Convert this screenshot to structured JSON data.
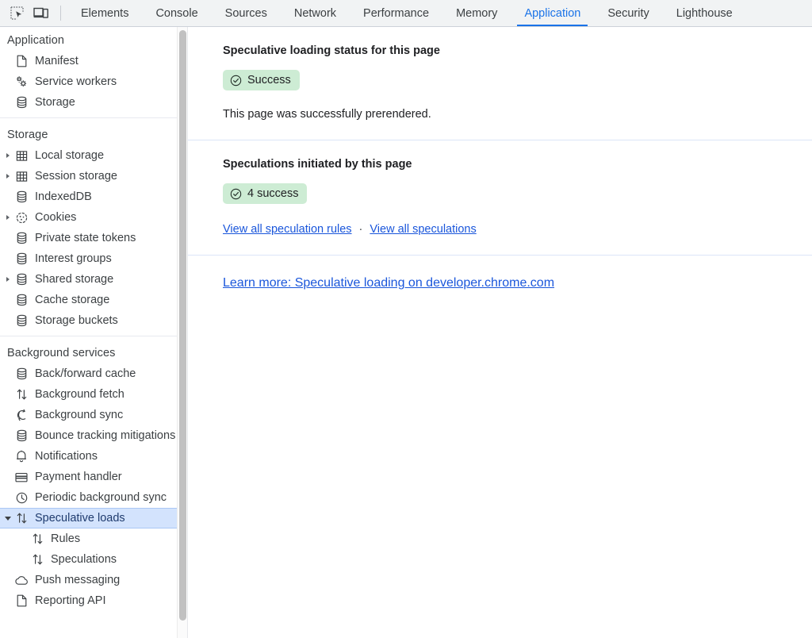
{
  "toolbar": {
    "icons": [
      {
        "name": "inspect-element-icon",
        "title": "Inspect element"
      },
      {
        "name": "device-toolbar-icon",
        "title": "Toggle device toolbar"
      }
    ],
    "tabs": [
      {
        "label": "Elements",
        "active": false
      },
      {
        "label": "Console",
        "active": false
      },
      {
        "label": "Sources",
        "active": false
      },
      {
        "label": "Network",
        "active": false
      },
      {
        "label": "Performance",
        "active": false
      },
      {
        "label": "Memory",
        "active": false
      },
      {
        "label": "Application",
        "active": true
      },
      {
        "label": "Security",
        "active": false
      },
      {
        "label": "Lighthouse",
        "active": false
      }
    ],
    "accent_color": "#1a73e8",
    "background_color": "#f1f3f4"
  },
  "sidebar": {
    "sections": [
      {
        "header": "Application",
        "items": [
          {
            "label": "Manifest",
            "icon": "document-icon",
            "arrow": "none",
            "level": 0,
            "selected": false
          },
          {
            "label": "Service workers",
            "icon": "gears-icon",
            "arrow": "none",
            "level": 0,
            "selected": false
          },
          {
            "label": "Storage",
            "icon": "database-icon",
            "arrow": "none",
            "level": 0,
            "selected": false
          }
        ]
      },
      {
        "header": "Storage",
        "items": [
          {
            "label": "Local storage",
            "icon": "table-icon",
            "arrow": "collapsed",
            "level": 0,
            "selected": false
          },
          {
            "label": "Session storage",
            "icon": "table-icon",
            "arrow": "collapsed",
            "level": 0,
            "selected": false
          },
          {
            "label": "IndexedDB",
            "icon": "database-icon",
            "arrow": "none",
            "level": 0,
            "selected": false
          },
          {
            "label": "Cookies",
            "icon": "cookie-icon",
            "arrow": "collapsed",
            "level": 0,
            "selected": false
          },
          {
            "label": "Private state tokens",
            "icon": "database-icon",
            "arrow": "none",
            "level": 0,
            "selected": false
          },
          {
            "label": "Interest groups",
            "icon": "database-icon",
            "arrow": "none",
            "level": 0,
            "selected": false
          },
          {
            "label": "Shared storage",
            "icon": "database-icon",
            "arrow": "collapsed",
            "level": 0,
            "selected": false
          },
          {
            "label": "Cache storage",
            "icon": "database-icon",
            "arrow": "none",
            "level": 0,
            "selected": false
          },
          {
            "label": "Storage buckets",
            "icon": "database-icon",
            "arrow": "none",
            "level": 0,
            "selected": false
          }
        ]
      },
      {
        "header": "Background services",
        "items": [
          {
            "label": "Back/forward cache",
            "icon": "database-icon",
            "arrow": "none",
            "level": 0,
            "selected": false
          },
          {
            "label": "Background fetch",
            "icon": "up-down-arrows-icon",
            "arrow": "none",
            "level": 0,
            "selected": false
          },
          {
            "label": "Background sync",
            "icon": "sync-icon",
            "arrow": "none",
            "level": 0,
            "selected": false
          },
          {
            "label": "Bounce tracking mitigations",
            "icon": "database-icon",
            "arrow": "none",
            "level": 0,
            "selected": false
          },
          {
            "label": "Notifications",
            "icon": "bell-icon",
            "arrow": "none",
            "level": 0,
            "selected": false
          },
          {
            "label": "Payment handler",
            "icon": "credit-card-icon",
            "arrow": "none",
            "level": 0,
            "selected": false
          },
          {
            "label": "Periodic background sync",
            "icon": "clock-icon",
            "arrow": "none",
            "level": 0,
            "selected": false
          },
          {
            "label": "Speculative loads",
            "icon": "up-down-arrows-icon",
            "arrow": "expanded",
            "level": 0,
            "selected": true
          },
          {
            "label": "Rules",
            "icon": "up-down-arrows-icon",
            "arrow": "none",
            "level": 1,
            "selected": false
          },
          {
            "label": "Speculations",
            "icon": "up-down-arrows-icon",
            "arrow": "none",
            "level": 1,
            "selected": false
          },
          {
            "label": "Push messaging",
            "icon": "cloud-icon",
            "arrow": "none",
            "level": 0,
            "selected": false
          },
          {
            "label": "Reporting API",
            "icon": "document-icon",
            "arrow": "none",
            "level": 0,
            "selected": false
          }
        ]
      }
    ],
    "selected_highlight_color": "#d3e3fd"
  },
  "main": {
    "status_section": {
      "title": "Speculative loading status for this page",
      "badge_label": "Success",
      "badge_icon": "check-circle-icon",
      "badge_color": "#cdecd4",
      "note": "This page was successfully prerendered."
    },
    "speculations_section": {
      "title": "Speculations initiated by this page",
      "badge_label": "4 success",
      "badge_icon": "check-circle-icon",
      "badge_color": "#cdecd4",
      "link_rules": "View all speculation rules",
      "link_separator": "·",
      "link_speculations": "View all speculations"
    },
    "learn_more": {
      "link": "Learn more: Speculative loading on developer.chrome.com",
      "link_color": "#1a56db"
    }
  }
}
